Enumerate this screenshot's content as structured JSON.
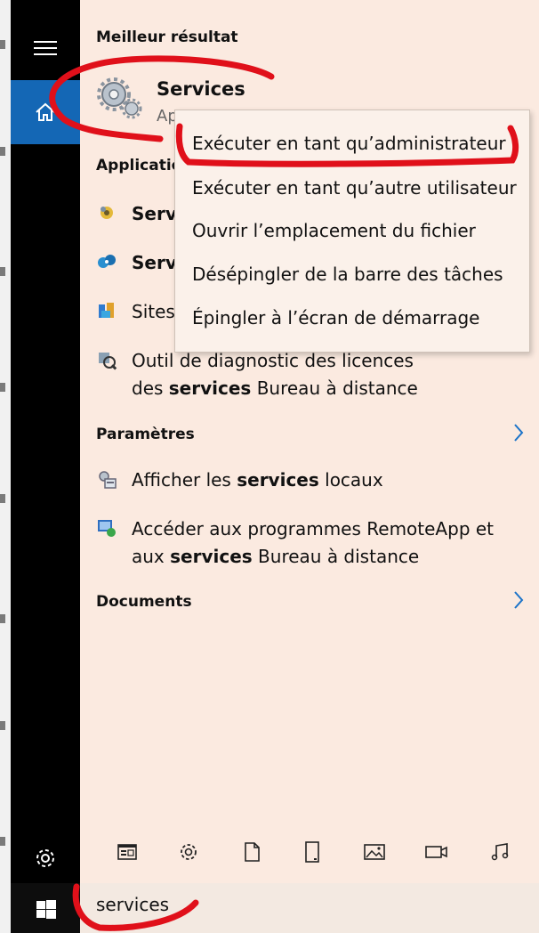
{
  "best_result": {
    "heading": "Meilleur résultat",
    "title": "Services",
    "subtitle": "Ap"
  },
  "context_menu": [
    "Exécuter en tant qu’administrateur",
    "Exécuter en tant qu’autre utilisateur",
    "Ouvrir l’emplacement du fichier",
    "Désépingler de la barre des tâches",
    "Épingler à l’écran de démarrage"
  ],
  "applications": {
    "heading": "Applicatio",
    "items": [
      {
        "label": "Serv"
      },
      {
        "label": "Serv"
      },
      {
        "label": "Sites"
      },
      {
        "line1": "Outil de diagnostic des licences",
        "line2_pre": "des ",
        "line2_bold": "services",
        "line2_post": " Bureau à distance"
      }
    ]
  },
  "parametres": {
    "heading": "Paramètres",
    "items": [
      {
        "pre": "Afficher les ",
        "bold": "services",
        "post": " locaux"
      },
      {
        "line1": "Accéder aux programmes RemoteApp et",
        "line2_pre": "aux ",
        "line2_bold": "services",
        "line2_post": " Bureau à distance"
      }
    ]
  },
  "documents": {
    "heading": "Documents"
  },
  "search": {
    "value": "services"
  },
  "colors": {
    "accent": "#1467b5",
    "panel": "#fbeae0",
    "annotation": "#e0101a"
  }
}
